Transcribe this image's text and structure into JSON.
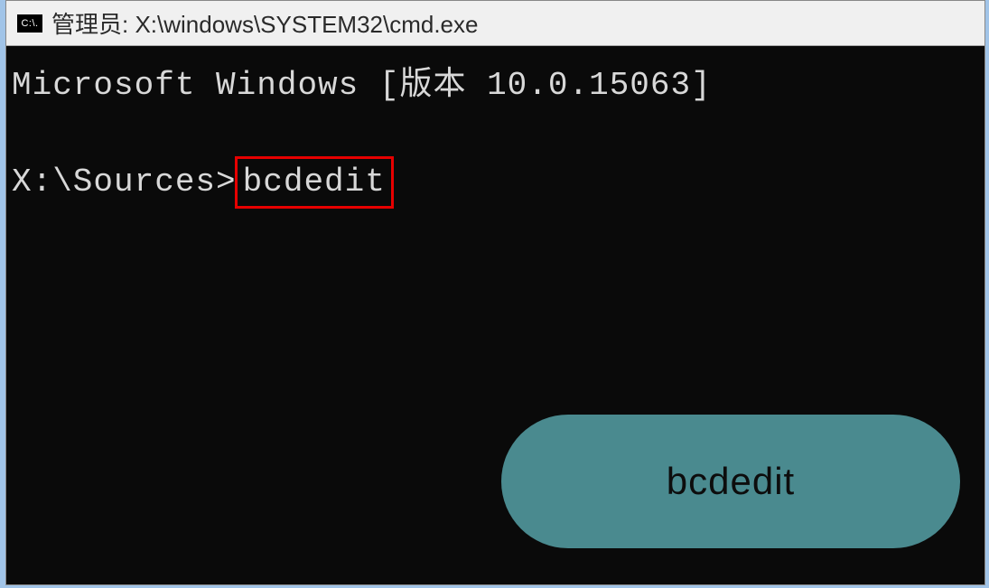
{
  "titlebar": {
    "icon_label": "C:\\.",
    "text": "管理员: X:\\windows\\SYSTEM32\\cmd.exe"
  },
  "terminal": {
    "header_line": "Microsoft Windows [版本 10.0.15063]",
    "prompt": "X:\\Sources>",
    "command": "bcdedit"
  },
  "annotation": {
    "label": "bcdedit"
  }
}
